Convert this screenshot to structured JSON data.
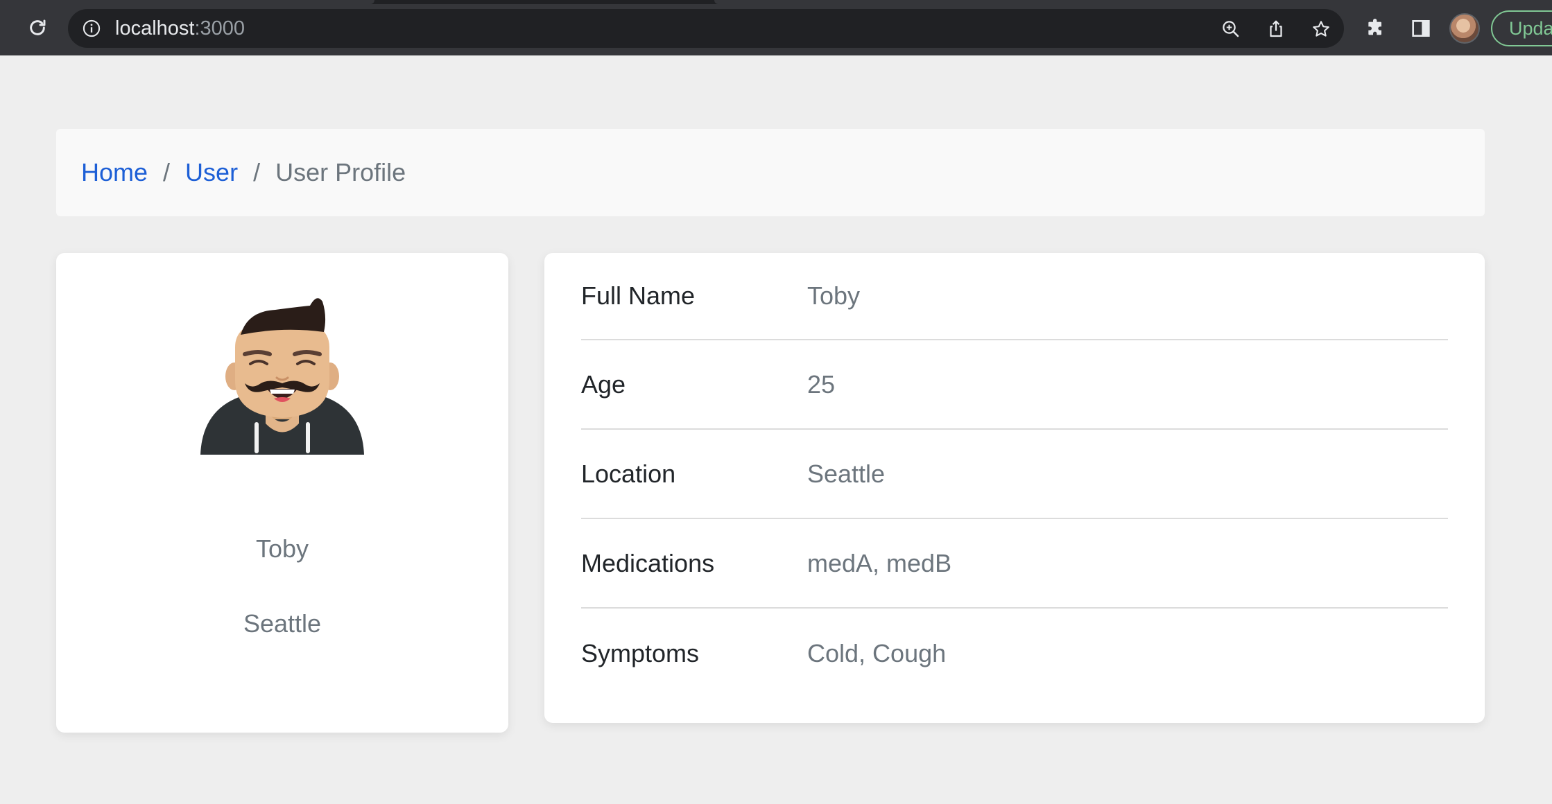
{
  "browser": {
    "url_host": "localhost",
    "url_port": ":3000",
    "update_label": "Update",
    "colors": {
      "chrome_bg": "#35363a",
      "omnibox_bg": "#202124",
      "update_accent": "#81c995"
    }
  },
  "breadcrumb": {
    "items": [
      {
        "label": "Home",
        "link": true
      },
      {
        "label": "User",
        "link": true
      },
      {
        "label": "User Profile",
        "link": false
      }
    ],
    "separator": "/"
  },
  "profile": {
    "avatar": "mustache-man-avatar",
    "name": "Toby",
    "location": "Seattle"
  },
  "details": [
    {
      "label": "Full Name",
      "value": "Toby"
    },
    {
      "label": "Age",
      "value": "25"
    },
    {
      "label": "Location",
      "value": "Seattle"
    },
    {
      "label": "Medications",
      "value": "medA, medB"
    },
    {
      "label": "Symptoms",
      "value": "Cold, Cough"
    }
  ],
  "colors": {
    "page_bg": "#eeeeee",
    "link": "#1d5fd6",
    "muted_text": "#6c757d",
    "label_text": "#212529",
    "card_bg": "#ffffff"
  }
}
